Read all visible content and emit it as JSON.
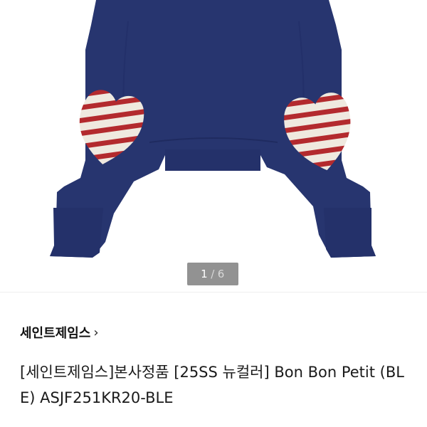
{
  "product": {
    "image_counter": {
      "current": "1",
      "separator": "/",
      "total": "6"
    },
    "brand_label": "세인트제임스",
    "brand_chevron": "›",
    "title": "[세인트제임스]본사정품 [25SS 뉴컬러] Bon Bon Petit (BLE) ASJF251KR20-BLE"
  },
  "colors": {
    "sweater": "#27356f",
    "stripe_red": "#b32a2e",
    "stripe_cream": "#efe9df"
  },
  "icons": {
    "brand_chevron": "chevron-right-icon"
  }
}
